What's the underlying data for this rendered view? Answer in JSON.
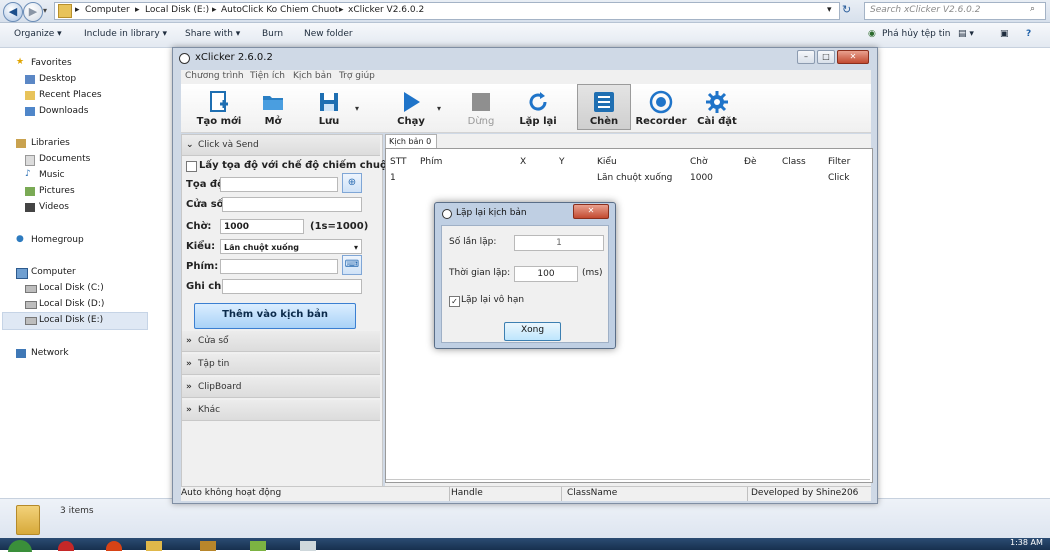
{
  "explorer": {
    "breadcrumbs": [
      "Computer",
      "Local Disk (E:)",
      "AutoClick Ko Chiem Chuot",
      "xClicker V2.6.0.2"
    ],
    "search_placeholder": "Search xClicker V2.6.0.2",
    "toolbar": {
      "organize": "Organize ▾",
      "include": "Include in library ▾",
      "share": "Share with ▾",
      "burn": "Burn",
      "new_folder": "New folder",
      "translate": "Phá hủy tệp tin"
    },
    "nav": {
      "favorites": "Favorites",
      "desktop": "Desktop",
      "recent": "Recent Places",
      "downloads": "Downloads",
      "libraries": "Libraries",
      "documents": "Documents",
      "music": "Music",
      "pictures": "Pictures",
      "videos": "Videos",
      "homegroup": "Homegroup",
      "computer": "Computer",
      "disk_c": "Local Disk (C:)",
      "disk_d": "Local Disk (D:)",
      "disk_e": "Local Disk (E:)",
      "network": "Network"
    },
    "status": {
      "items": "3 items",
      "clock": "1:38 AM"
    }
  },
  "app": {
    "title": "xClicker 2.6.0.2",
    "menu": [
      "Chương trình",
      "Tiện ích",
      "Kịch bản",
      "Trợ giúp"
    ],
    "ribbon": {
      "new": "Tạo mới",
      "open": "Mở",
      "save": "Lưu",
      "run": "Chạy",
      "stop": "Dừng",
      "repeat": "Lặp lại",
      "insert": "Chèn",
      "recorder": "Recorder",
      "settings": "Cài đặt"
    },
    "left": {
      "section_click": "Click và Send",
      "checkbox_label": "Lấy tọa độ với chế độ chiếm chuột",
      "coord_label": "Tọa độ:",
      "window_label": "Cửa sổ:",
      "wait_label": "Chờ:",
      "wait_value": "1000",
      "wait_hint": "(1s=1000)",
      "type_label": "Kiểu:",
      "type_value": "Lăn chuột xuống",
      "key_label": "Phím:",
      "note_label": "Ghi chú:",
      "add_button": "Thêm vào kịch bản",
      "section_window": "Cửa sổ",
      "section_file": "Tập tin",
      "section_clipboard": "ClipBoard",
      "section_other": "Khác"
    },
    "tab": "Kịch bản 0 *",
    "table": {
      "columns": [
        "STT",
        "Phím",
        "X",
        "Y",
        "Kiểu",
        "Chờ",
        "Đè",
        "Class",
        "Filter"
      ],
      "rows": [
        {
          "stt": "1",
          "phim": "",
          "x": "",
          "y": "",
          "kieu": "Lăn chuột xuống",
          "cho": "1000",
          "de": "",
          "class": "",
          "filter": "Click"
        }
      ]
    },
    "statusbar": {
      "auto": "Auto không hoạt động",
      "handle": "Handle",
      "classname": "ClassName",
      "developer": "Developed by Shine206"
    }
  },
  "dialog": {
    "title": "Lặp lại kịch bản",
    "count_label": "Số lần lặp:",
    "count_value": "1",
    "time_label": "Thời gian lặp:",
    "time_value": "100",
    "time_unit": "(ms)",
    "infinite_label": "Lặp lại vô hạn",
    "infinite_checked": true,
    "ok": "Xong"
  },
  "colors": {
    "accent": "#3b7fd1",
    "window_frame": "#cfd9e6",
    "taskbar": "#1f3a5c"
  }
}
